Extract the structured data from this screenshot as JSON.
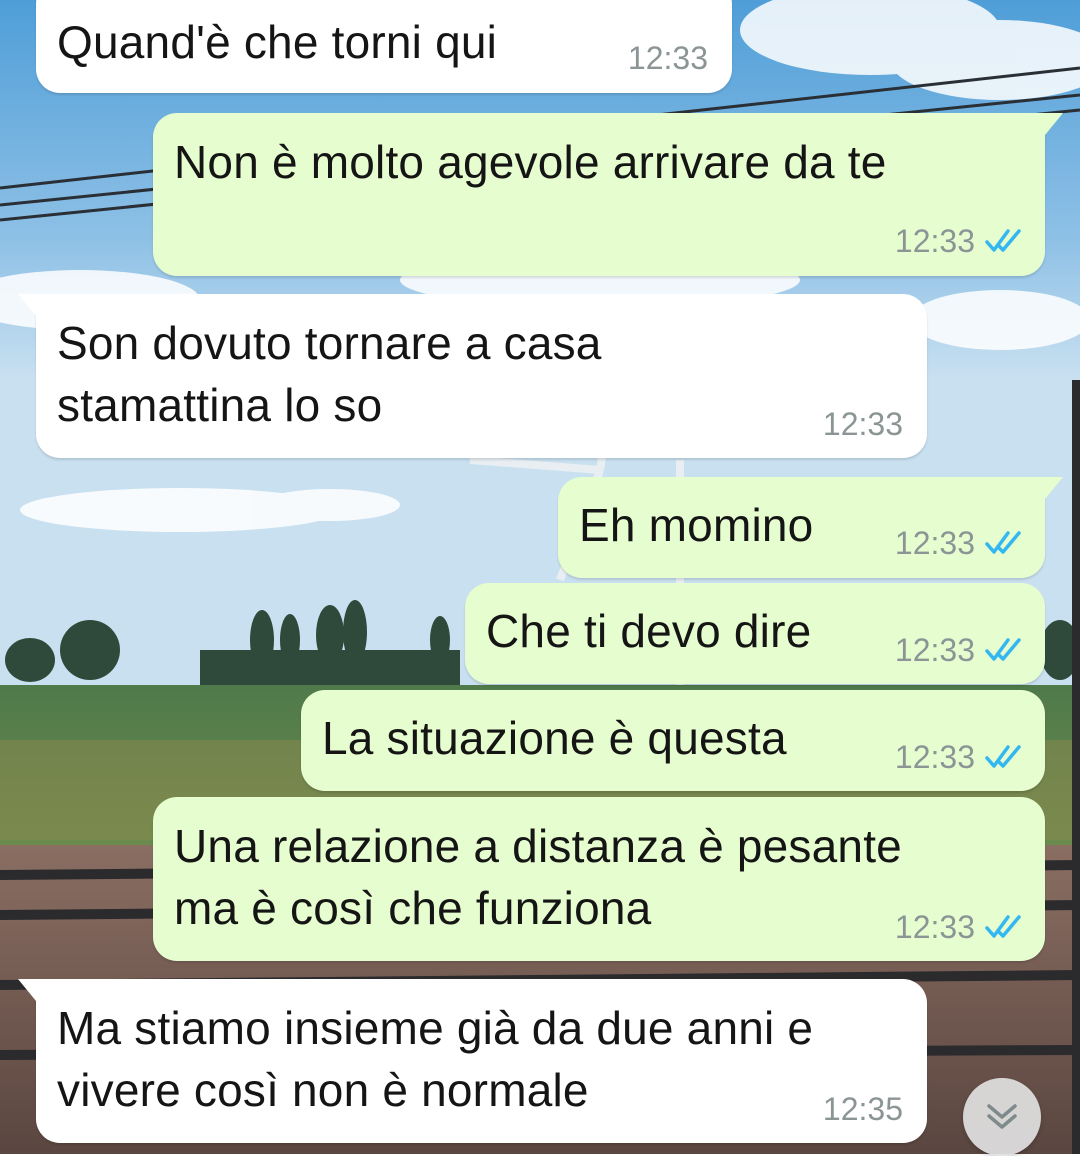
{
  "colors": {
    "incoming_bubble": "#ffffff",
    "outgoing_bubble": "#e6fecf",
    "text": "#151515",
    "timestamp": "#8c9596",
    "read_ticks": "#34b7f1"
  },
  "messages": [
    {
      "direction": "incoming",
      "text": "Quand'è che torni qui",
      "time": "12:33"
    },
    {
      "direction": "outgoing",
      "text": "Non è molto agevole arrivare da te",
      "time": "12:33",
      "status_icon": "double-check-read-icon"
    },
    {
      "direction": "incoming",
      "lines": [
        "Son dovuto tornare a casa",
        "stamattina lo so"
      ],
      "time": "12:33"
    },
    {
      "direction": "outgoing",
      "text": "Eh momino",
      "time": "12:33",
      "status_icon": "double-check-read-icon"
    },
    {
      "direction": "outgoing",
      "text": "Che ti devo dire",
      "time": "12:33",
      "status_icon": "double-check-read-icon"
    },
    {
      "direction": "outgoing",
      "text": "La situazione è questa",
      "time": "12:33",
      "status_icon": "double-check-read-icon"
    },
    {
      "direction": "outgoing",
      "lines": [
        "Una relazione a distanza è pesante",
        "ma è così che funziona"
      ],
      "time": "12:33",
      "status_icon": "double-check-read-icon"
    },
    {
      "direction": "incoming",
      "lines": [
        "Ma stiamo insieme già da due anni e",
        "vivere così non è normale"
      ],
      "time": "12:35"
    }
  ],
  "scroll_button": {
    "icon": "double-chevron-down-icon"
  }
}
